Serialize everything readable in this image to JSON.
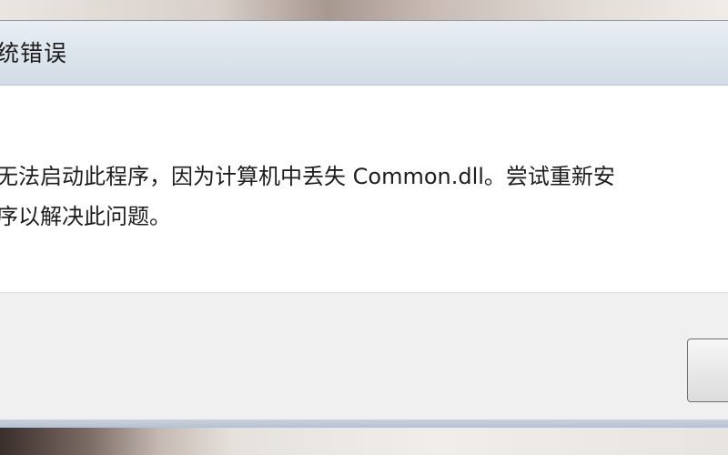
{
  "window": {
    "title": "统错误"
  },
  "message": {
    "line1": "无法启动此程序，因为计算机中丢失 Common.dll。尝试重新安",
    "line2": "序以解决此问题。"
  },
  "buttons": {
    "ok_label": ""
  },
  "colors": {
    "content_background": "#ffffff",
    "footer_background": "#f0f0f0",
    "title_bar": "#dce4ec"
  }
}
